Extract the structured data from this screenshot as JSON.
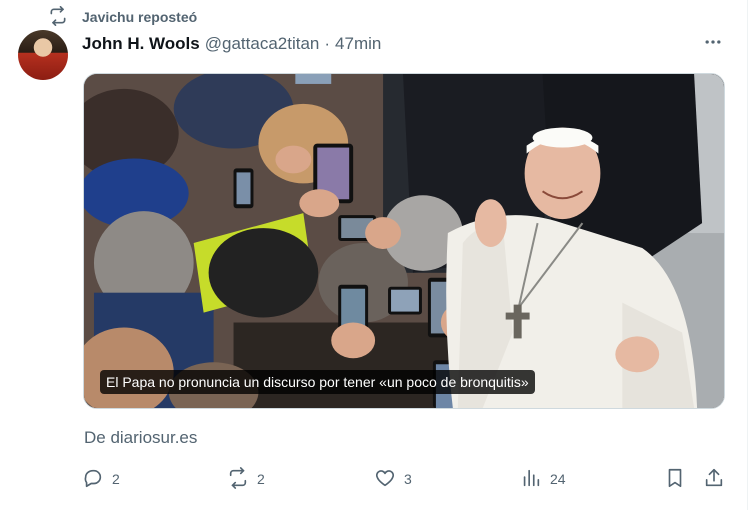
{
  "repost": {
    "text": "Javichu reposteó",
    "icon": "repost-icon"
  },
  "author": {
    "display_name": "John H. Wools",
    "handle": "@gattaca2titan",
    "separator": "·",
    "time": "47min"
  },
  "media": {
    "caption": "El Papa no pronuncia un discurso por tener «un poco de bronquitis»"
  },
  "source": "De diariosur.es",
  "actions": {
    "replies": "2",
    "reposts": "2",
    "likes": "3",
    "views": "24"
  },
  "colors": {
    "text_primary": "#0f1419",
    "text_secondary": "#536471",
    "border": "#cfd9de"
  }
}
